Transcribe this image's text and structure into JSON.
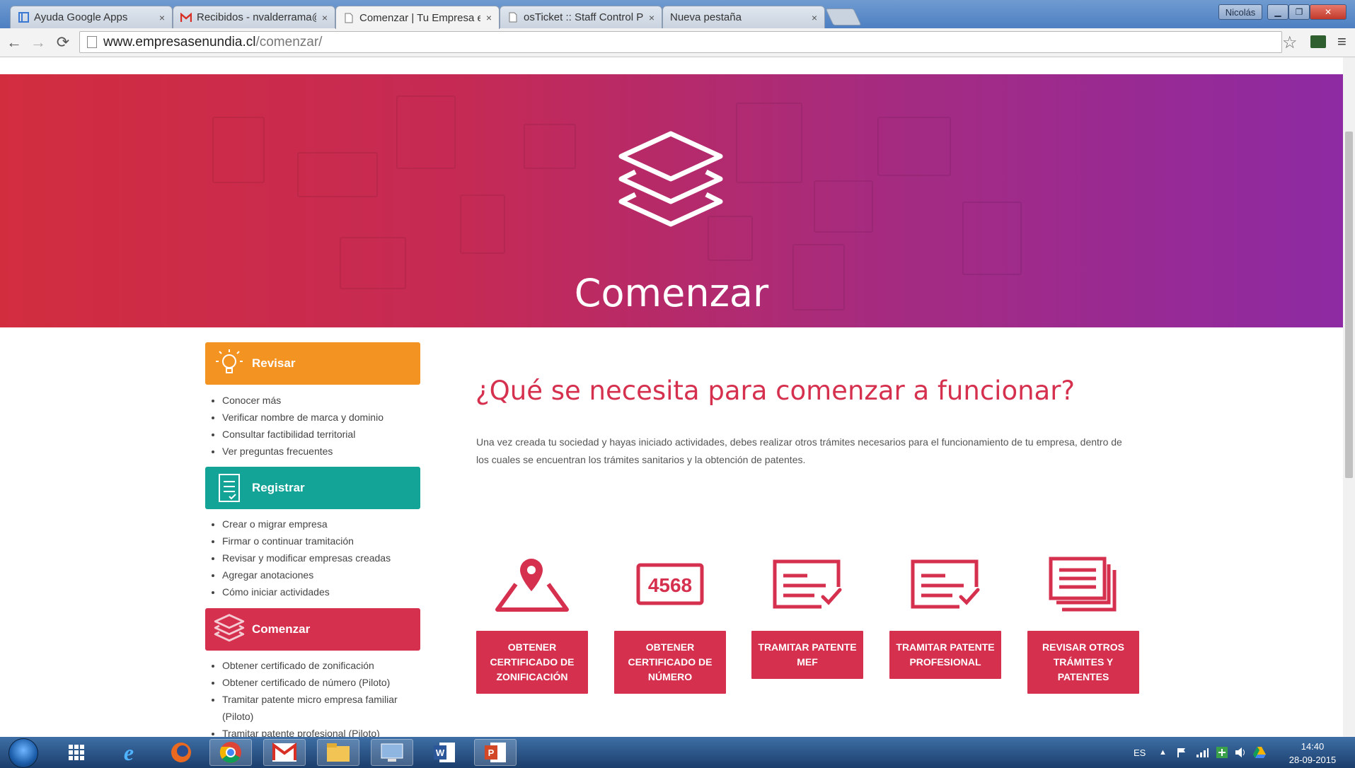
{
  "browser": {
    "tabs": [
      {
        "label": "Ayuda Google Apps",
        "icon": "google-apps-icon",
        "active": false
      },
      {
        "label": "Recibidos - nvalderrama@",
        "icon": "gmail-icon",
        "active": false
      },
      {
        "label": "Comenzar | Tu Empresa e",
        "icon": "page-icon",
        "active": true
      },
      {
        "label": "osTicket :: Staff Control Pa",
        "icon": "page-icon",
        "active": false
      },
      {
        "label": "Nueva pestaña",
        "icon": "",
        "active": false
      }
    ],
    "close_glyph": "×",
    "user_label": "Nicolás",
    "url_host": "www.empresasenundia.cl",
    "url_path": "/comenzar/"
  },
  "hero": {
    "title": "Comenzar"
  },
  "sidebar": {
    "sections": [
      {
        "title": "Revisar",
        "color": "#f39322",
        "icon": "lightbulb-icon",
        "items": [
          "Conocer más",
          "Verificar nombre de marca y dominio",
          "Consultar factibilidad territorial",
          "Ver preguntas frecuentes"
        ]
      },
      {
        "title": "Registrar",
        "color": "#14a397",
        "icon": "document-icon",
        "items": [
          "Crear o migrar empresa",
          "Firmar o continuar tramitación",
          "Revisar y modificar empresas creadas",
          "Agregar anotaciones",
          "Cómo iniciar actividades"
        ]
      },
      {
        "title": "Comenzar",
        "color": "#d6304f",
        "icon": "layers-icon",
        "items": [
          "Obtener certificado de zonificación",
          "Obtener certificado de número (Piloto)",
          "Tramitar patente micro empresa familiar (Piloto)",
          "Tramitar patente profesional (Piloto)"
        ]
      }
    ]
  },
  "main": {
    "title": "¿Qué se necesita para comenzar a funcionar?",
    "description": "Una vez creada tu sociedad y hayas iniciado actividades, debes realizar otros trámites necesarios para el funcionamiento de tu empresa, dentro de los cuales se encuentran los trámites sanitarios y la obtención de patentes.",
    "accent_color": "#d6304f",
    "cards": [
      {
        "label": "OBTENER CERTIFICADO DE ZONIFICACIÓN",
        "icon": "map-pin-icon"
      },
      {
        "label": "OBTENER CERTIFICADO DE NÚMERO",
        "icon": "number-plate-icon",
        "icon_text": "4568"
      },
      {
        "label": "TRAMITAR PATENTE MEF",
        "icon": "certificate-check-icon"
      },
      {
        "label": "TRAMITAR PATENTE PROFESIONAL",
        "icon": "certificate-check-icon"
      },
      {
        "label": "REVISAR OTROS TRÁMITES Y PATENTES",
        "icon": "documents-stack-icon"
      }
    ]
  },
  "taskbar": {
    "apps": [
      "start-orb",
      "metro-icon",
      "internet-explorer-icon",
      "firefox-icon",
      "chrome-icon",
      "gmail-icon",
      "file-explorer-icon",
      "remote-desktop-icon",
      "word-icon",
      "powerpoint-icon"
    ],
    "language": "ES",
    "time": "14:40",
    "date": "28-09-2015"
  }
}
